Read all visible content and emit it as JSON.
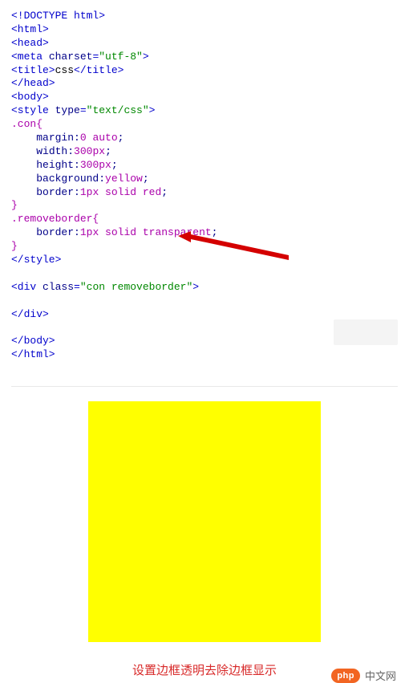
{
  "code": {
    "l1_a": "<!DOCTYPE html",
    "l1_b": ">",
    "l2": "<html>",
    "l3": "<head>",
    "l4_a": "<meta",
    "l4_b": " charset",
    "l4_c": "=",
    "l4_d": "\"utf-8\"",
    "l4_e": ">",
    "l5_a": "<title>",
    "l5_b": "css",
    "l5_c": "</title>",
    "l6": "</head>",
    "l7": "<body>",
    "l8_a": "<style",
    "l8_b": " type",
    "l8_c": "=",
    "l8_d": "\"text/css\"",
    "l8_e": ">",
    "l9": ".con{",
    "l10_a": "margin",
    "l10_b": ":",
    "l10_c": "0 auto",
    "l10_d": ";",
    "l11_a": "width",
    "l11_b": ":",
    "l11_c": "300px",
    "l11_d": ";",
    "l12_a": "height",
    "l12_b": ":",
    "l12_c": "300px",
    "l12_d": ";",
    "l13_a": "background",
    "l13_b": ":",
    "l13_c": "yellow",
    "l13_d": ";",
    "l14_a": "border",
    "l14_b": ":",
    "l14_c": "1px solid red",
    "l14_d": ";",
    "l15": "}",
    "l16": ".removeborder{",
    "l17_a": "border",
    "l17_b": ":",
    "l17_c": "1px solid transparent",
    "l17_d": ";",
    "l18": "}",
    "l19": "</style>",
    "l20": " ",
    "l21_a": "<div",
    "l21_b": " class",
    "l21_c": "=",
    "l21_d": "\"con removeborder\"",
    "l21_e": ">",
    "l22": " ",
    "l23": "</div>",
    "l24": " ",
    "l25": "</body>",
    "l26": "</html>"
  },
  "caption": "设置边框透明去除边框显示",
  "watermark": {
    "badge": "php",
    "text": "中文网"
  }
}
